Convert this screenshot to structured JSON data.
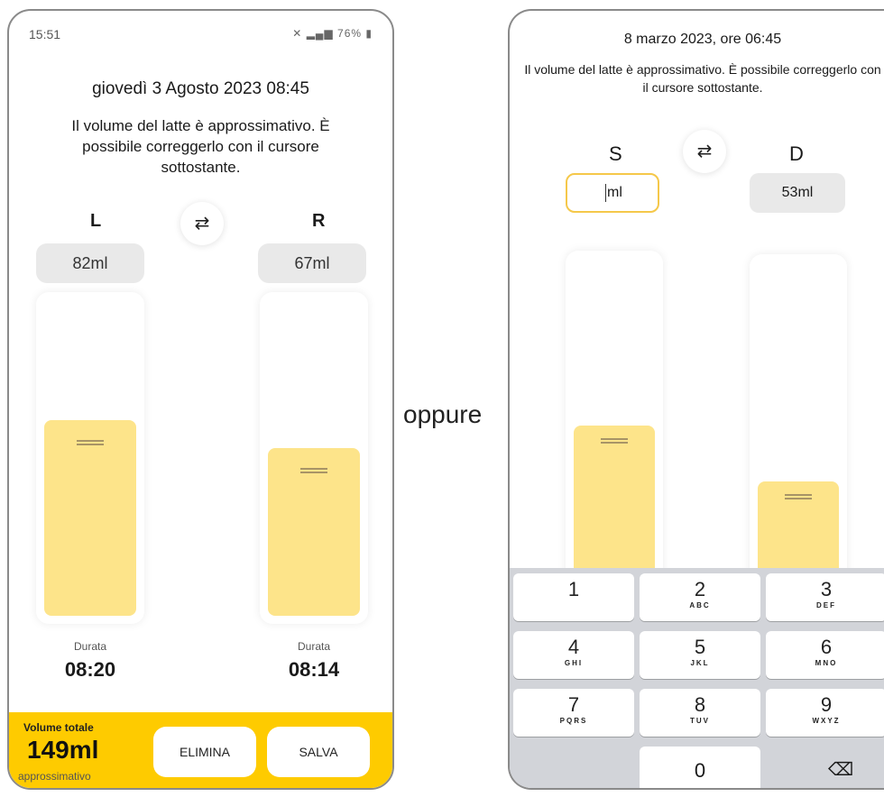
{
  "phone_left": {
    "status_time": "15:51",
    "status_icons": "76%",
    "date": "giovedì 3 Agosto 2023 08:45",
    "note": "Il volume del latte è approssimativo. È possibile correggerlo con il cursore sottostante.",
    "left": {
      "label": "L",
      "volume": "82ml",
      "fill_fraction": 0.62,
      "duration_label": "Durata",
      "duration": "08:20"
    },
    "right": {
      "label": "R",
      "volume": "67ml",
      "fill_fraction": 0.53,
      "duration_label": "Durata",
      "duration": "08:14"
    },
    "swap_icon": "⇄",
    "footer": {
      "total_label": "Volume totale",
      "total_value": "149ml",
      "total_sub": "approssimativo",
      "delete_label": "ELIMINA",
      "save_label": "SALVA"
    }
  },
  "separator": "oppure",
  "phone_right": {
    "date": "8 marzo 2023, ore 06:45",
    "note": "Il volume del latte è approssimativo. È possibile correggerlo con il cursore sottostante.",
    "swap_icon": "⇄",
    "left": {
      "label": "S",
      "input_value": "ml",
      "fill_fraction": 0.49
    },
    "right": {
      "label": "D",
      "volume": "53ml",
      "fill_fraction": 0.32
    },
    "keyboard": {
      "keys": [
        {
          "num": "1",
          "letters": ""
        },
        {
          "num": "2",
          "letters": "ABC"
        },
        {
          "num": "3",
          "letters": "DEF"
        },
        {
          "num": "4",
          "letters": "GHI"
        },
        {
          "num": "5",
          "letters": "JKL"
        },
        {
          "num": "6",
          "letters": "MNO"
        },
        {
          "num": "7",
          "letters": "PQRS"
        },
        {
          "num": "8",
          "letters": "TUV"
        },
        {
          "num": "9",
          "letters": "WXYZ"
        }
      ],
      "zero": "0",
      "backspace_icon": "⌫"
    }
  }
}
